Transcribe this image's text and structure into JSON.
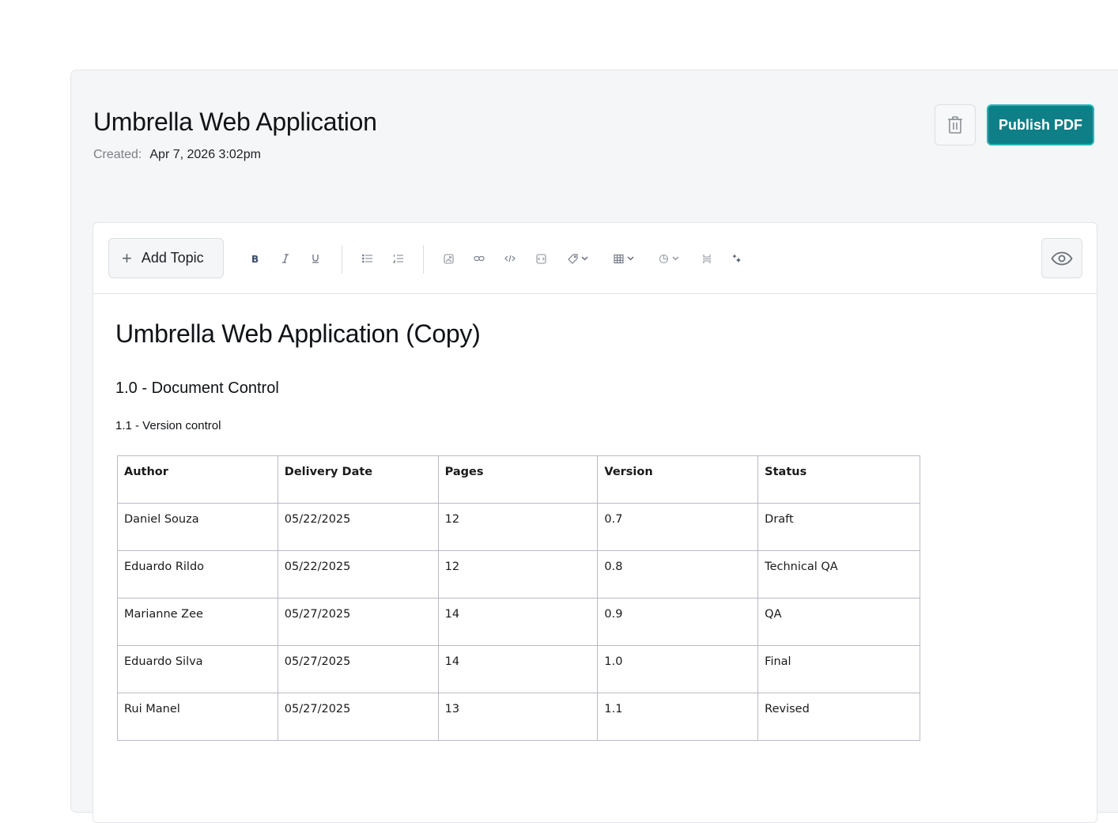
{
  "header": {
    "title": "Umbrella Web Application",
    "created_label": "Created:",
    "created_value": "Apr 7, 2026 3:02pm",
    "publish_label": "Publish PDF"
  },
  "toolbar": {
    "add_topic_label": "Add Topic",
    "icons": [
      "bold-icon",
      "italic-icon",
      "underline-icon",
      "bullet-list-icon",
      "numbered-list-icon",
      "image-icon",
      "link-icon",
      "code-icon",
      "embed-icon",
      "tag-icon",
      "table-icon",
      "chart-icon",
      "page-break-icon",
      "magic-icon",
      "eye-icon"
    ]
  },
  "content": {
    "h1": "Umbrella Web Application (Copy)",
    "h2": "1.0 - Document Control",
    "h3": "1.1 - Version control",
    "table": {
      "headers": [
        "Author",
        "Delivery Date",
        "Pages",
        "Version",
        "Status"
      ],
      "rows": [
        [
          "Daniel Souza",
          "05/22/2025",
          "12",
          "0.7",
          "Draft"
        ],
        [
          "Eduardo Rildo",
          "05/22/2025",
          "12",
          "0.8",
          "Technical QA"
        ],
        [
          "Marianne Zee",
          "05/27/2025",
          "14",
          "0.9",
          "QA"
        ],
        [
          "Eduardo Silva",
          "05/27/2025",
          "14",
          "1.0",
          "Final"
        ],
        [
          "Rui Manel",
          "05/27/2025",
          "13",
          "1.1",
          "Revised"
        ]
      ]
    }
  },
  "colors": {
    "accent": "#0e7f86",
    "accent_border": "#22b8b4",
    "panel_bg": "#f5f6f7"
  }
}
